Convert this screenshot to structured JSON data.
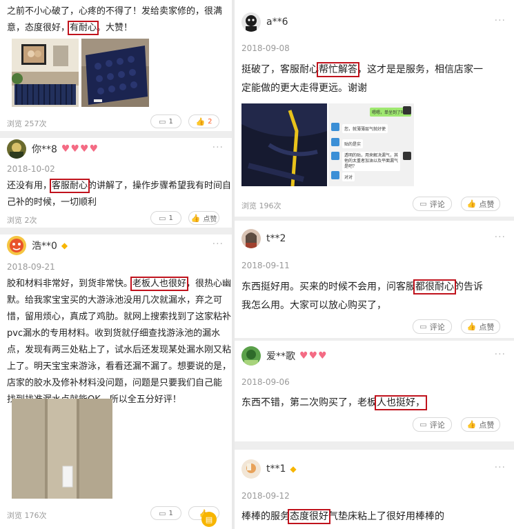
{
  "left": {
    "card1": {
      "text_line1": "之前不小心破了，心疼的不得了！发给卖家修的，很满",
      "text_line2_a": "意，态度很好，",
      "text_line2_mark": "有耐心",
      "text_line2_b": "。大赞！",
      "views": "浏览 257次",
      "comment_count": "1",
      "like_count": "2"
    },
    "card2": {
      "username": "你**8",
      "date": "2018-10-02",
      "text_line1_a": "还没有用，",
      "text_line1_mark": "客服耐心",
      "text_line1_b": "的讲解了，操作步骤希望我有时间自",
      "text_line2": "己补的时候，一切顺利",
      "views": "浏览 2次",
      "comment_count": "1",
      "like_label": "点赞"
    },
    "card3": {
      "username": "浩**0",
      "date": "2018-09-21",
      "line1_a": "胶和材料非常好，到货非常快。",
      "line1_mark": "老板人也很好",
      "line1_b": "，很热心幽",
      "line2": "默。给我家宝宝买的大游泳池没用几次就漏水，弃之可",
      "line3": "惜，留用烦心，真成了鸡肋。就网上搜索找到了这家粘补",
      "line4": "pvc漏水的专用材料。收到货就仔细查找游泳池的漏水",
      "line5": "点，发现有两三处粘上了，试水后还发现某处漏水刚又粘",
      "line6": "上了。明天宝宝来游泳，看看还漏不漏了。想要说的是，",
      "line7": "店家的胶水及修补材料没问题，问题是只要我们自己能",
      "line8": "找到找准漏水点就能OK。所以全五分好评！",
      "views": "浏览 176次",
      "comment_count": "1"
    }
  },
  "right": {
    "card1": {
      "username": "a**6",
      "date": "2018-09-08",
      "line1_a": "挺破了，客服耐心",
      "line1_mark": "帮忙解答",
      "line1_b": "，这才是是服务，相信店家一",
      "line2": "定能做的更大走得更远。谢谢",
      "chat_msg1": "嗯嗯，单坐到了吗？",
      "chat_msg2": "您，就薄薄层气就好使",
      "chat_msg3": "贴的是实",
      "chat_msg4": "透明的贴，用来解决漏气，其他的太重者加油以及平面漏气是吧？",
      "chat_msg5": "对对",
      "views": "浏览 196次",
      "comment_label": "评论",
      "like_label": "点赞"
    },
    "card2": {
      "username": "t**2",
      "date": "2018-09-11",
      "line1_a": "东西挺好用。买来的时候不会用，问客服",
      "line1_mark": "都很耐心",
      "line1_b": "的告诉",
      "line2": "我怎么用。大家可以放心购买了，",
      "comment_label": "评论",
      "like_label": "点赞"
    },
    "card3": {
      "username": "爱**歌",
      "date": "2018-09-06",
      "line1_a": "东西不错，第二次购买了，老板",
      "line1_mark": "人也挺好，",
      "comment_label": "评论",
      "like_label": "点赞"
    },
    "card4": {
      "username": "t**1",
      "date": "2018-09-12",
      "line1_a": "棒棒的服务",
      "line1_mark": "态度很好",
      "line1_b": "气垫床粘上了很好用棒棒的"
    }
  },
  "icons": {
    "comment": "comment-icon",
    "like": "thumbs-up-icon",
    "more": "more-dots-icon",
    "vip": "diamond-icon"
  },
  "colors": {
    "highlight_box": "#c0121c",
    "heart": "#f46b84",
    "liked": "#ff5a1f",
    "diamond": "#f7b500"
  }
}
